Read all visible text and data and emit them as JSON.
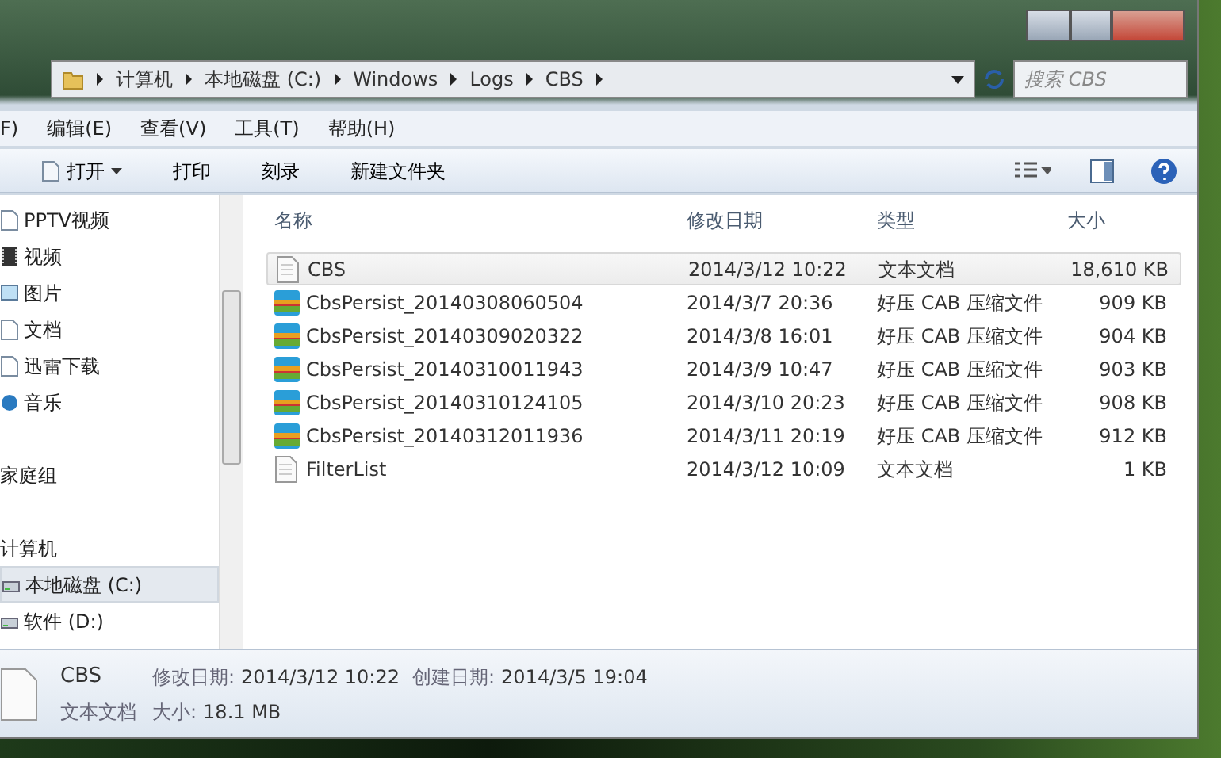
{
  "address_bar": {
    "path": [
      "计算机",
      "本地磁盘 (C:)",
      "Windows",
      "Logs",
      "CBS"
    ]
  },
  "search": {
    "placeholder": "搜索 CBS"
  },
  "menu": [
    "F)",
    "编辑(E)",
    "查看(V)",
    "工具(T)",
    "帮助(H)"
  ],
  "toolbar": [
    {
      "label": "打开",
      "kind": "open"
    },
    {
      "label": "打印",
      "kind": "plain"
    },
    {
      "label": "刻录",
      "kind": "plain"
    },
    {
      "label": "新建文件夹",
      "kind": "plain"
    }
  ],
  "nav": [
    {
      "label": "PPTV视频",
      "kind": "doc",
      "selected": false
    },
    {
      "label": "视频",
      "kind": "video",
      "selected": false
    },
    {
      "label": "图片",
      "kind": "picture",
      "selected": false
    },
    {
      "label": "文档",
      "kind": "doc",
      "selected": false
    },
    {
      "label": "迅雷下载",
      "kind": "doc",
      "selected": false
    },
    {
      "label": "音乐",
      "kind": "music",
      "selected": false
    },
    {
      "label": "家庭组",
      "kind": "group",
      "selected": false
    },
    {
      "label": "计算机",
      "kind": "group",
      "selected": false,
      "children": [
        {
          "label": "本地磁盘 (C:)",
          "kind": "drive",
          "selected": true
        },
        {
          "label": "软件 (D:)",
          "kind": "drive",
          "selected": false
        }
      ]
    }
  ],
  "table": {
    "columns": [
      "名称",
      "修改日期",
      "类型",
      "大小"
    ],
    "rows": [
      {
        "name": "CBS",
        "date": "2014/3/12 10:22",
        "type": "文本文档",
        "size": "18,610 KB",
        "kind": "text",
        "selected": true
      },
      {
        "name": "CbsPersist_20140308060504",
        "date": "2014/3/7 20:36",
        "type": "好压 CAB 压缩文件",
        "size": "909 KB",
        "kind": "archive",
        "selected": false
      },
      {
        "name": "CbsPersist_20140309020322",
        "date": "2014/3/8 16:01",
        "type": "好压 CAB 压缩文件",
        "size": "904 KB",
        "kind": "archive",
        "selected": false
      },
      {
        "name": "CbsPersist_20140310011943",
        "date": "2014/3/9 10:47",
        "type": "好压 CAB 压缩文件",
        "size": "903 KB",
        "kind": "archive",
        "selected": false
      },
      {
        "name": "CbsPersist_20140310124105",
        "date": "2014/3/10 20:23",
        "type": "好压 CAB 压缩文件",
        "size": "908 KB",
        "kind": "archive",
        "selected": false
      },
      {
        "name": "CbsPersist_20140312011936",
        "date": "2014/3/11 20:19",
        "type": "好压 CAB 压缩文件",
        "size": "912 KB",
        "kind": "archive",
        "selected": false
      },
      {
        "name": "FilterList",
        "date": "2014/3/12 10:09",
        "type": "文本文档",
        "size": "1 KB",
        "kind": "text",
        "selected": false
      }
    ]
  },
  "details": {
    "name": "CBS",
    "type": "文本文档",
    "modified_label": "修改日期:",
    "modified": "2014/3/12 10:22",
    "size_label": "大小:",
    "size": "18.1 MB",
    "created_label": "创建日期:",
    "created": "2014/3/5 19:04"
  }
}
